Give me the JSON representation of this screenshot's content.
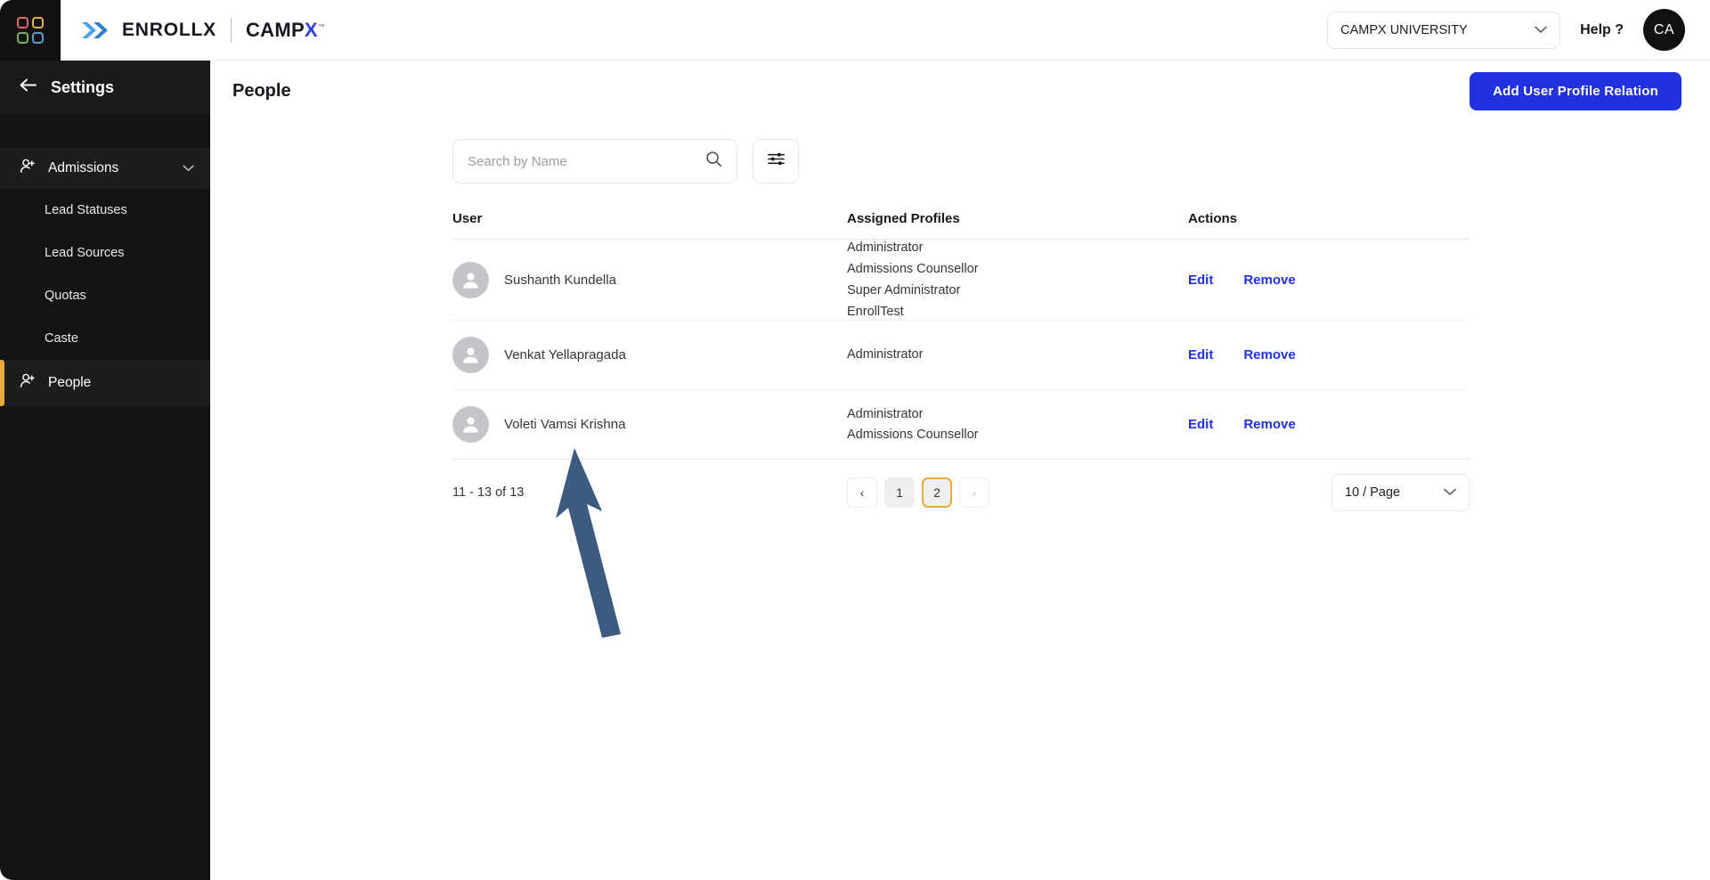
{
  "topbar": {
    "logo_icon": "grid-4-squares-icon",
    "logo_dot_colors": [
      "#d96a6a",
      "#e0b24a",
      "#7fb069",
      "#5b9ec9"
    ],
    "brand_primary": "ENROLLX",
    "brand_secondary": "CAMP",
    "brand_secondary_accent": "X",
    "brand_trademark": "™",
    "org_selector_value": "CAMPX UNIVERSITY",
    "help_label": "Help ?",
    "avatar_initials": "CA"
  },
  "sidebar": {
    "back_label": "Settings",
    "group": {
      "label": "Admissions",
      "icon": "user-add-icon",
      "chevron": "chevron-down-icon"
    },
    "sub_items": [
      {
        "label": "Lead Statuses"
      },
      {
        "label": "Lead Sources"
      },
      {
        "label": "Quotas"
      },
      {
        "label": "Caste"
      }
    ],
    "items": [
      {
        "label": "People",
        "icon": "user-add-icon",
        "active": true
      }
    ],
    "active_indicator_color": "#e8a93d"
  },
  "page": {
    "title": "People",
    "primary_button": "Add User Profile Relation",
    "primary_button_color": "#2131e0"
  },
  "search": {
    "placeholder": "Search by Name",
    "value": "",
    "search_icon": "search-icon",
    "filter_icon": "filter-sliders-icon"
  },
  "table": {
    "columns": [
      "User",
      "Assigned Profiles",
      "Actions"
    ],
    "rows": [
      {
        "name": "Sushanth Kundella",
        "profiles": [
          "Administrator",
          "Admissions Counsellor",
          "Super Administrator",
          "EnrollTest"
        ],
        "actions": [
          "Edit",
          "Remove"
        ]
      },
      {
        "name": "Venkat Yellapragada",
        "profiles": [
          "Administrator"
        ],
        "actions": [
          "Edit",
          "Remove"
        ]
      },
      {
        "name": "Voleti Vamsi Krishna",
        "profiles": [
          "Administrator",
          "Admissions Counsellor"
        ],
        "actions": [
          "Edit",
          "Remove"
        ]
      }
    ]
  },
  "pagination": {
    "range_text": "11 - 13 of 13",
    "prev_label": "‹",
    "next_label": "›",
    "pages": [
      "1",
      "2"
    ],
    "current_page": "2",
    "per_page_label": "10 / Page",
    "active_border_color": "#e8a93d"
  },
  "annotation": {
    "arrow_color": "#3d5a7f",
    "points_at": "Voleti Vamsi Krishna"
  }
}
